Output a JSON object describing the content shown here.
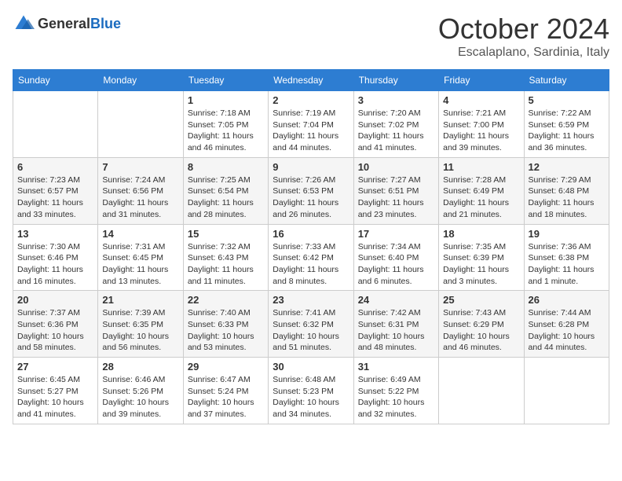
{
  "header": {
    "logo_general": "General",
    "logo_blue": "Blue",
    "month": "October 2024",
    "location": "Escalaplano, Sardinia, Italy"
  },
  "weekdays": [
    "Sunday",
    "Monday",
    "Tuesday",
    "Wednesday",
    "Thursday",
    "Friday",
    "Saturday"
  ],
  "weeks": [
    [
      {
        "day": "",
        "info": ""
      },
      {
        "day": "",
        "info": ""
      },
      {
        "day": "1",
        "info": "Sunrise: 7:18 AM\nSunset: 7:05 PM\nDaylight: 11 hours and 46 minutes."
      },
      {
        "day": "2",
        "info": "Sunrise: 7:19 AM\nSunset: 7:04 PM\nDaylight: 11 hours and 44 minutes."
      },
      {
        "day": "3",
        "info": "Sunrise: 7:20 AM\nSunset: 7:02 PM\nDaylight: 11 hours and 41 minutes."
      },
      {
        "day": "4",
        "info": "Sunrise: 7:21 AM\nSunset: 7:00 PM\nDaylight: 11 hours and 39 minutes."
      },
      {
        "day": "5",
        "info": "Sunrise: 7:22 AM\nSunset: 6:59 PM\nDaylight: 11 hours and 36 minutes."
      }
    ],
    [
      {
        "day": "6",
        "info": "Sunrise: 7:23 AM\nSunset: 6:57 PM\nDaylight: 11 hours and 33 minutes."
      },
      {
        "day": "7",
        "info": "Sunrise: 7:24 AM\nSunset: 6:56 PM\nDaylight: 11 hours and 31 minutes."
      },
      {
        "day": "8",
        "info": "Sunrise: 7:25 AM\nSunset: 6:54 PM\nDaylight: 11 hours and 28 minutes."
      },
      {
        "day": "9",
        "info": "Sunrise: 7:26 AM\nSunset: 6:53 PM\nDaylight: 11 hours and 26 minutes."
      },
      {
        "day": "10",
        "info": "Sunrise: 7:27 AM\nSunset: 6:51 PM\nDaylight: 11 hours and 23 minutes."
      },
      {
        "day": "11",
        "info": "Sunrise: 7:28 AM\nSunset: 6:49 PM\nDaylight: 11 hours and 21 minutes."
      },
      {
        "day": "12",
        "info": "Sunrise: 7:29 AM\nSunset: 6:48 PM\nDaylight: 11 hours and 18 minutes."
      }
    ],
    [
      {
        "day": "13",
        "info": "Sunrise: 7:30 AM\nSunset: 6:46 PM\nDaylight: 11 hours and 16 minutes."
      },
      {
        "day": "14",
        "info": "Sunrise: 7:31 AM\nSunset: 6:45 PM\nDaylight: 11 hours and 13 minutes."
      },
      {
        "day": "15",
        "info": "Sunrise: 7:32 AM\nSunset: 6:43 PM\nDaylight: 11 hours and 11 minutes."
      },
      {
        "day": "16",
        "info": "Sunrise: 7:33 AM\nSunset: 6:42 PM\nDaylight: 11 hours and 8 minutes."
      },
      {
        "day": "17",
        "info": "Sunrise: 7:34 AM\nSunset: 6:40 PM\nDaylight: 11 hours and 6 minutes."
      },
      {
        "day": "18",
        "info": "Sunrise: 7:35 AM\nSunset: 6:39 PM\nDaylight: 11 hours and 3 minutes."
      },
      {
        "day": "19",
        "info": "Sunrise: 7:36 AM\nSunset: 6:38 PM\nDaylight: 11 hours and 1 minute."
      }
    ],
    [
      {
        "day": "20",
        "info": "Sunrise: 7:37 AM\nSunset: 6:36 PM\nDaylight: 10 hours and 58 minutes."
      },
      {
        "day": "21",
        "info": "Sunrise: 7:39 AM\nSunset: 6:35 PM\nDaylight: 10 hours and 56 minutes."
      },
      {
        "day": "22",
        "info": "Sunrise: 7:40 AM\nSunset: 6:33 PM\nDaylight: 10 hours and 53 minutes."
      },
      {
        "day": "23",
        "info": "Sunrise: 7:41 AM\nSunset: 6:32 PM\nDaylight: 10 hours and 51 minutes."
      },
      {
        "day": "24",
        "info": "Sunrise: 7:42 AM\nSunset: 6:31 PM\nDaylight: 10 hours and 48 minutes."
      },
      {
        "day": "25",
        "info": "Sunrise: 7:43 AM\nSunset: 6:29 PM\nDaylight: 10 hours and 46 minutes."
      },
      {
        "day": "26",
        "info": "Sunrise: 7:44 AM\nSunset: 6:28 PM\nDaylight: 10 hours and 44 minutes."
      }
    ],
    [
      {
        "day": "27",
        "info": "Sunrise: 6:45 AM\nSunset: 5:27 PM\nDaylight: 10 hours and 41 minutes."
      },
      {
        "day": "28",
        "info": "Sunrise: 6:46 AM\nSunset: 5:26 PM\nDaylight: 10 hours and 39 minutes."
      },
      {
        "day": "29",
        "info": "Sunrise: 6:47 AM\nSunset: 5:24 PM\nDaylight: 10 hours and 37 minutes."
      },
      {
        "day": "30",
        "info": "Sunrise: 6:48 AM\nSunset: 5:23 PM\nDaylight: 10 hours and 34 minutes."
      },
      {
        "day": "31",
        "info": "Sunrise: 6:49 AM\nSunset: 5:22 PM\nDaylight: 10 hours and 32 minutes."
      },
      {
        "day": "",
        "info": ""
      },
      {
        "day": "",
        "info": ""
      }
    ]
  ]
}
